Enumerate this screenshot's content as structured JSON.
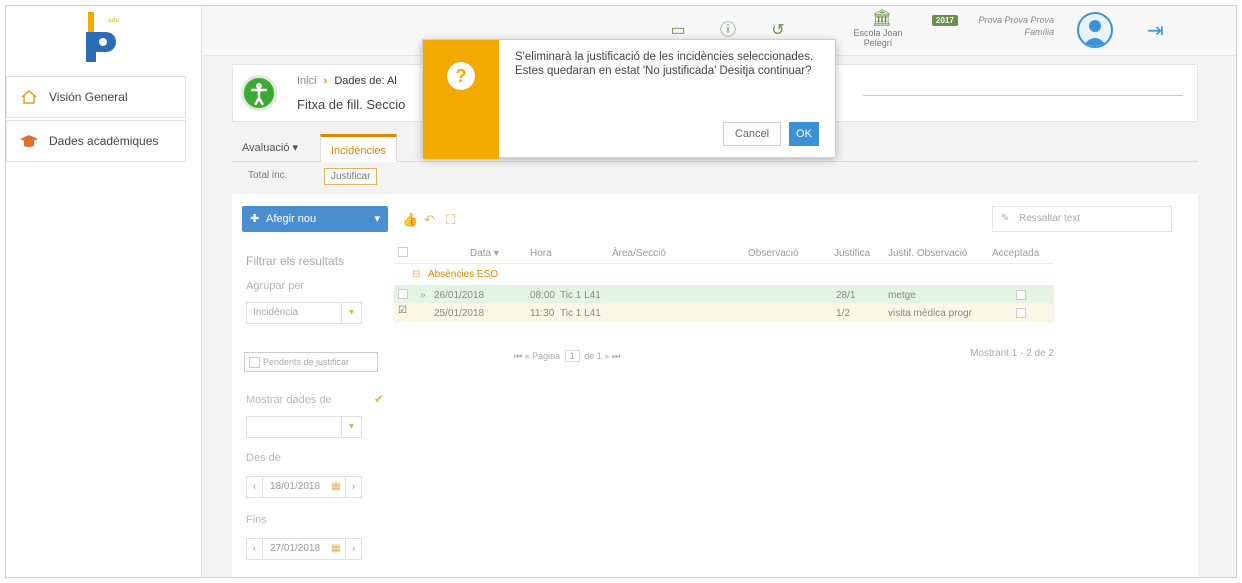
{
  "app": {
    "logo_text": "",
    "year_badge": "2017"
  },
  "sidebar": {
    "items": [
      {
        "label": "Visión General"
      },
      {
        "label": "Dades acadèmiques"
      }
    ]
  },
  "topbar": {
    "school_name": "Escola Joan Pelegrí",
    "user_name": "Prova Prova Prova",
    "user_role": "Família"
  },
  "card": {
    "breadcrumb_home": "Inici",
    "breadcrumb_current": "Dades de: Al",
    "title": "Fitxa de fill. Seccio"
  },
  "tabs": [
    {
      "label": "Avaluació ▾"
    },
    {
      "label": "Incidències"
    }
  ],
  "subtabs": [
    {
      "label": "Total inc."
    },
    {
      "label": "Justificar"
    }
  ],
  "toolbar": {
    "add_label": "Afegir nou",
    "highlight_placeholder": "Ressaltar text"
  },
  "filters": {
    "title": "Filtrar els resultats",
    "group_label": "Agrupar per",
    "group_value": "Incidència",
    "pending_label": "Pendents de justificar",
    "show_label": "Mostrar dades de",
    "from_label": "Des de",
    "from_date": "18/01/2018",
    "to_label": "Fins",
    "to_date": "27/01/2018"
  },
  "grid": {
    "headers": [
      "Data ▾",
      "Hora",
      "Àrea/Secció",
      "Observació",
      "Justifica",
      "Justif. Observació",
      "Acceptada"
    ],
    "group_label": "Absències ESO",
    "rows": [
      {
        "date": "26/01/2018",
        "time": "08:00",
        "area": "Tic 1 L41",
        "observation": "",
        "justifica": "28/1",
        "justif_obs": "metge",
        "checked": false
      },
      {
        "date": "25/01/2018",
        "time": "11:30",
        "area": "Tic 1 L41",
        "observation": "",
        "justifica": "1/2",
        "justif_obs": "visita mèdica progr",
        "checked": true
      }
    ],
    "pager_text": "Pàgina",
    "pager_page": "1",
    "pager_of": "de 1",
    "counter": "Mostrant 1 - 2 de 2"
  },
  "dialog": {
    "message": "S'eliminarà la justificació de les incidències seleccionades. Estes quedaran en estat 'No justificada' Desitja continuar?",
    "cancel_label": "Cancel",
    "ok_label": "OK"
  }
}
